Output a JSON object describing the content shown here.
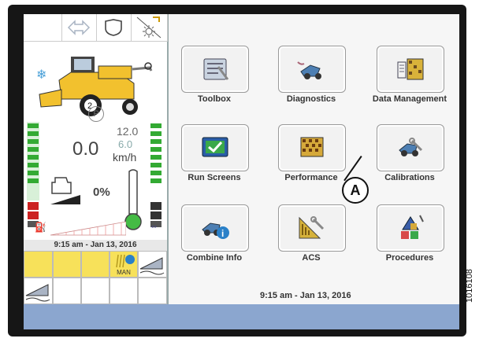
{
  "left_panel": {
    "speed_value": "0.0",
    "speed_max": "12.0",
    "speed_set": "6.0",
    "speed_unit": "km/h",
    "percent": "0%",
    "gear": "2",
    "park": "P",
    "timestamp": "9:15 am - Jan 13, 2016",
    "man_label": "MAN"
  },
  "apps": [
    {
      "label": "Toolbox"
    },
    {
      "label": "Diagnostics"
    },
    {
      "label": "Data Management"
    },
    {
      "label": "Run Screens"
    },
    {
      "label": "Performance"
    },
    {
      "label": "Calibrations"
    },
    {
      "label": "Combine Info"
    },
    {
      "label": "ACS"
    },
    {
      "label": "Procedures"
    }
  ],
  "footer": {
    "timestamp": "9:15 am - Jan 13, 2016"
  },
  "callout": "A",
  "document_id": "1016108",
  "colors": {
    "bottom_bar": "#8ba6cf",
    "field_yellow": "#f7e15a",
    "gauge_green": "#33aa33",
    "gauge_red": "#cc2222"
  }
}
